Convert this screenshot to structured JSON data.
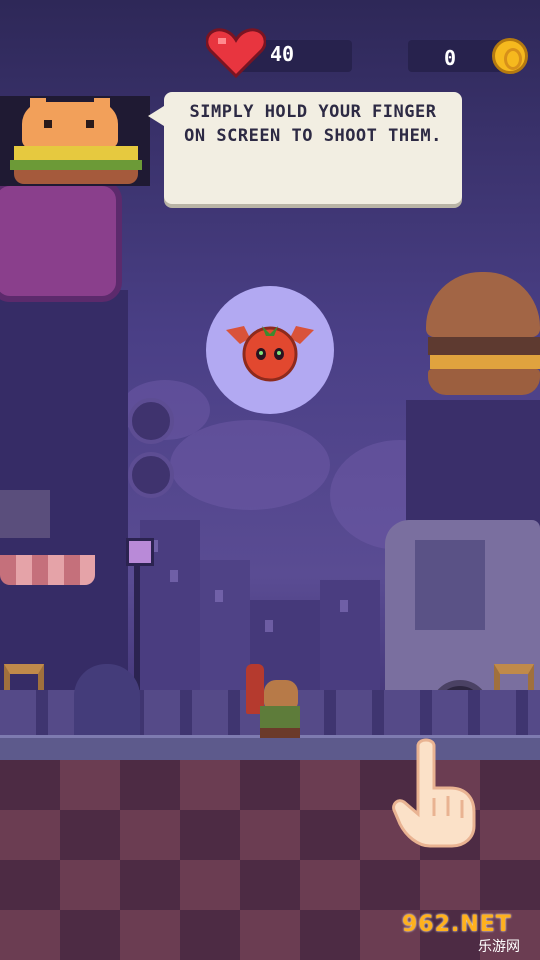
{
  "hud": {
    "health_icon": "heart-icon",
    "health_value": "40",
    "coin_value": "0",
    "coin_icon": "coin-icon"
  },
  "tutorial": {
    "speaker": "hamster-burger-mascot",
    "message": "SIMPLY HOLD YOUR FINGER ON SCREEN TO SHOOT THEM."
  },
  "enemy": {
    "name": "flying-tomato-bat",
    "highlight_color": "#b2a9f2"
  },
  "player": {
    "name": "hamster-with-ketchup-gun"
  },
  "gesture": {
    "icon": "pointing-hand-icon"
  },
  "watermark": {
    "text": "962.NET",
    "subtext": "乐游网"
  },
  "colors": {
    "heart": "#e8353f",
    "coin": "#f6b91e",
    "hud_background": "#27224d",
    "bubble_background": "#f2eee2"
  }
}
